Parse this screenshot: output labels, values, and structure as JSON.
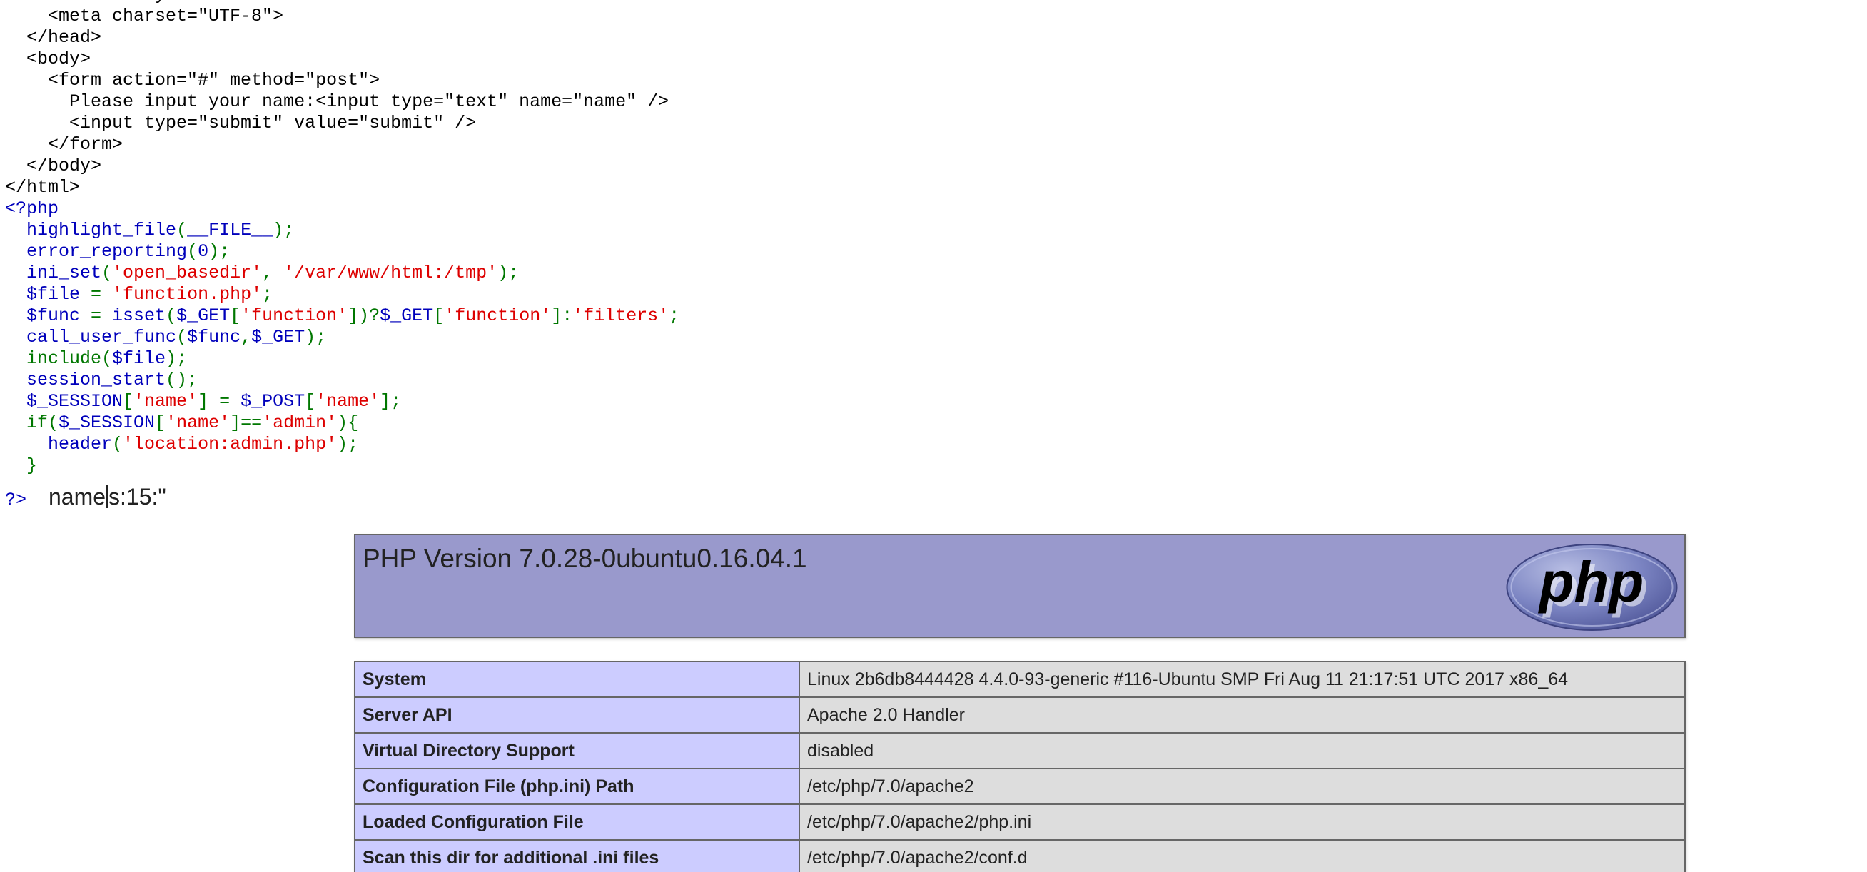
{
  "source_code": {
    "lines": [
      [
        [
          "html",
          "    <title>BabyPHP</title>"
        ]
      ],
      [
        [
          "html",
          "    <meta charset=\"UTF-8\">"
        ]
      ],
      [
        [
          "html",
          "  </head>"
        ]
      ],
      [
        [
          "html",
          "  <body>"
        ]
      ],
      [
        [
          "html",
          "    <form action=\"#\" method=\"post\">"
        ]
      ],
      [
        [
          "html",
          "      Please input your name:<input type=\"text\" name=\"name\" />"
        ]
      ],
      [
        [
          "html",
          "      <input type=\"submit\" value=\"submit\" />"
        ]
      ],
      [
        [
          "html",
          "    </form>"
        ]
      ],
      [
        [
          "html",
          "  </body>"
        ]
      ],
      [
        [
          "html",
          "</html>"
        ]
      ],
      [
        [
          "default",
          "<?php"
        ]
      ],
      [
        [
          "default",
          "  highlight_file"
        ],
        [
          "keyword",
          "("
        ],
        [
          "default",
          "__FILE__"
        ],
        [
          "keyword",
          ");"
        ]
      ],
      [
        [
          "default",
          "  error_reporting"
        ],
        [
          "keyword",
          "("
        ],
        [
          "default",
          "0"
        ],
        [
          "keyword",
          ");"
        ]
      ],
      [
        [
          "default",
          "  ini_set"
        ],
        [
          "keyword",
          "("
        ],
        [
          "string",
          "'open_basedir'"
        ],
        [
          "keyword",
          ", "
        ],
        [
          "string",
          "'/var/www/html:/tmp'"
        ],
        [
          "keyword",
          ");"
        ]
      ],
      [
        [
          "default",
          "  $file "
        ],
        [
          "keyword",
          "= "
        ],
        [
          "string",
          "'function.php'"
        ],
        [
          "keyword",
          ";"
        ]
      ],
      [
        [
          "default",
          "  $func "
        ],
        [
          "keyword",
          "= "
        ],
        [
          "default",
          "isset"
        ],
        [
          "keyword",
          "("
        ],
        [
          "default",
          "$_GET"
        ],
        [
          "keyword",
          "["
        ],
        [
          "string",
          "'function'"
        ],
        [
          "keyword",
          "])?"
        ],
        [
          "default",
          "$_GET"
        ],
        [
          "keyword",
          "["
        ],
        [
          "string",
          "'function'"
        ],
        [
          "keyword",
          "]:"
        ],
        [
          "string",
          "'filters'"
        ],
        [
          "keyword",
          ";"
        ]
      ],
      [
        [
          "default",
          "  call_user_func"
        ],
        [
          "keyword",
          "("
        ],
        [
          "default",
          "$func"
        ],
        [
          "keyword",
          ","
        ],
        [
          "default",
          "$_GET"
        ],
        [
          "keyword",
          ");"
        ]
      ],
      [
        [
          "keyword",
          "  include("
        ],
        [
          "default",
          "$file"
        ],
        [
          "keyword",
          ");"
        ]
      ],
      [
        [
          "default",
          "  session_start"
        ],
        [
          "keyword",
          "();"
        ]
      ],
      [
        [
          "default",
          "  $_SESSION"
        ],
        [
          "keyword",
          "["
        ],
        [
          "string",
          "'name'"
        ],
        [
          "keyword",
          "] = "
        ],
        [
          "default",
          "$_POST"
        ],
        [
          "keyword",
          "["
        ],
        [
          "string",
          "'name'"
        ],
        [
          "keyword",
          "];"
        ]
      ],
      [
        [
          "keyword",
          "  if("
        ],
        [
          "default",
          "$_SESSION"
        ],
        [
          "keyword",
          "["
        ],
        [
          "string",
          "'name'"
        ],
        [
          "keyword",
          "]=="
        ],
        [
          "string",
          "'admin'"
        ],
        [
          "keyword",
          "){"
        ]
      ],
      [
        [
          "default",
          "    header"
        ],
        [
          "keyword",
          "("
        ],
        [
          "string",
          "'location:admin.php'"
        ],
        [
          "keyword",
          ");"
        ]
      ],
      [
        [
          "keyword",
          "  }"
        ]
      ]
    ],
    "close_tag": "?>",
    "token_colors": {
      "html": "#000000",
      "default": "#0000BB",
      "keyword": "#007700",
      "string": "#DD0000"
    }
  },
  "session_output": {
    "before_caret": "name",
    "after_caret": "s:15:\""
  },
  "phpinfo": {
    "version_title": "PHP Version 7.0.28-0ubuntu0.16.04.1",
    "logo_text": "php",
    "header_color": "#9999CC",
    "key_color": "#CCCCFF",
    "value_color": "#DDDDDD",
    "rows": [
      {
        "key": "System",
        "value": "Linux 2b6db8444428 4.4.0-93-generic #116-Ubuntu SMP Fri Aug 11 21:17:51 UTC 2017 x86_64"
      },
      {
        "key": "Server API",
        "value": "Apache 2.0 Handler"
      },
      {
        "key": "Virtual Directory Support",
        "value": "disabled"
      },
      {
        "key": "Configuration File (php.ini) Path",
        "value": "/etc/php/7.0/apache2"
      },
      {
        "key": "Loaded Configuration File",
        "value": "/etc/php/7.0/apache2/php.ini"
      },
      {
        "key": "Scan this dir for additional .ini files",
        "value": "/etc/php/7.0/apache2/conf.d"
      }
    ]
  }
}
